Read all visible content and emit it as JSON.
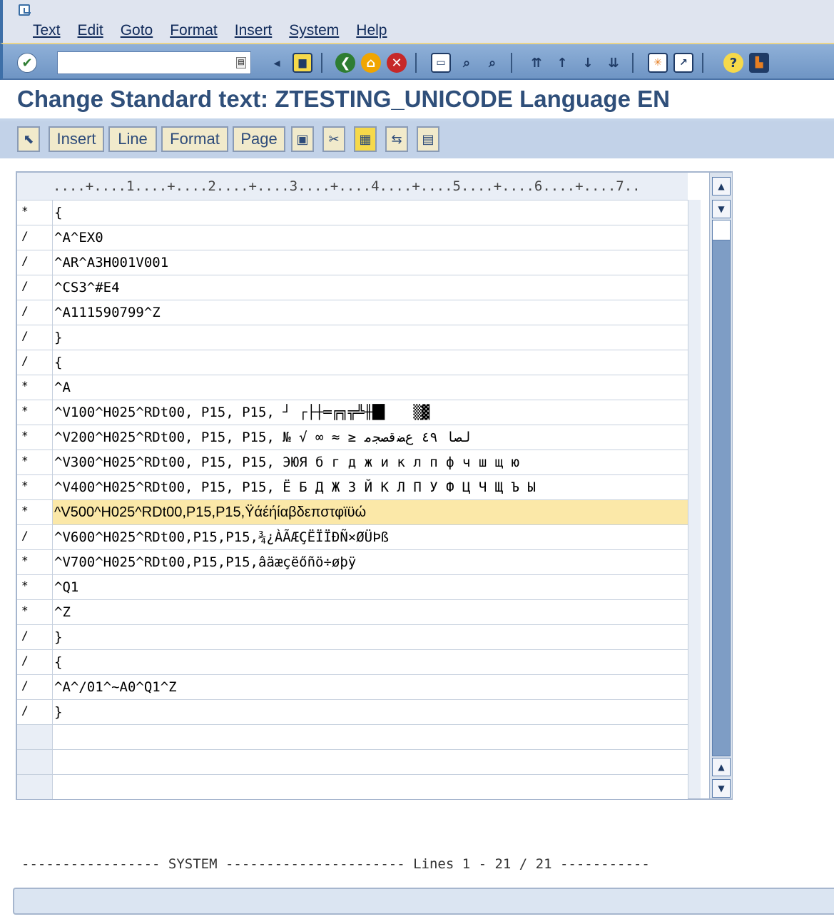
{
  "menu": [
    "Text",
    "Edit",
    "Goto",
    "Format",
    "Insert",
    "System",
    "Help"
  ],
  "command_field": {
    "value": "",
    "placeholder": ""
  },
  "title": "Change Standard text: ZTESTING_UNICODE Language EN",
  "app_toolbar": {
    "buttons": [
      "Insert",
      "Line",
      "Format",
      "Page"
    ]
  },
  "ruler": "....+....1....+....2....+....3....+....4....+....5....+....6....+....7..",
  "rows": [
    {
      "fmt": "*",
      "text": "{"
    },
    {
      "fmt": "/",
      "text": "^A^EX0"
    },
    {
      "fmt": "/",
      "text": "^AR^A3H001V001"
    },
    {
      "fmt": "/",
      "text": "^CS3^#E4"
    },
    {
      "fmt": "/",
      "text": "^A111590799^Z"
    },
    {
      "fmt": "/",
      "text": "}"
    },
    {
      "fmt": "/",
      "text": "{"
    },
    {
      "fmt": "*",
      "text": "^A"
    },
    {
      "fmt": "*",
      "text": "^V100^H025^RDt00, P15, P15, ┘ ┌├┼═╔╗╦╩╫█▌   ▒▓"
    },
    {
      "fmt": "*",
      "text": "^V200^H025^RDt00, P15, P15, № √ ∞ ≈ ≥ لصا ٤٩ ﻉﻀﻗﺼﺠﻣ"
    },
    {
      "fmt": "*",
      "text": "^V300^H025^RDt00, P15, P15, ЭЮЯ б г д ж и к л п ф ч ш щ ю"
    },
    {
      "fmt": "*",
      "text": "^V400^H025^RDt00, P15, P15, Ё Б Д Ж З Й К Л П У Ф Ц Ч Щ Ъ Ы"
    },
    {
      "fmt": "*",
      "text": "^V500^H025^RDt00,P15,P15,Ÿάέήίαβδεπστφϊϋώ"
    },
    {
      "fmt": "/",
      "text": "^V600^H025^RDt00,P15,P15,¾¿ÀÃÆÇËÏÏÐÑ×ØÜÞß"
    },
    {
      "fmt": "*",
      "text": "^V700^H025^RDt00,P15,P15,âäæçëőñö÷øþÿ"
    },
    {
      "fmt": "*",
      "text": "^Q1"
    },
    {
      "fmt": "*",
      "text": "^Z"
    },
    {
      "fmt": "/",
      "text": "}"
    },
    {
      "fmt": "/",
      "text": "{"
    },
    {
      "fmt": "/",
      "text": "^A^/01^~A0^Q1^Z"
    },
    {
      "fmt": "/",
      "text": "}"
    }
  ],
  "highlighted_row_index": 12,
  "footer": "----------------- SYSTEM ---------------------- Lines 1 - 21 / 21 -----------",
  "status_bar": ""
}
